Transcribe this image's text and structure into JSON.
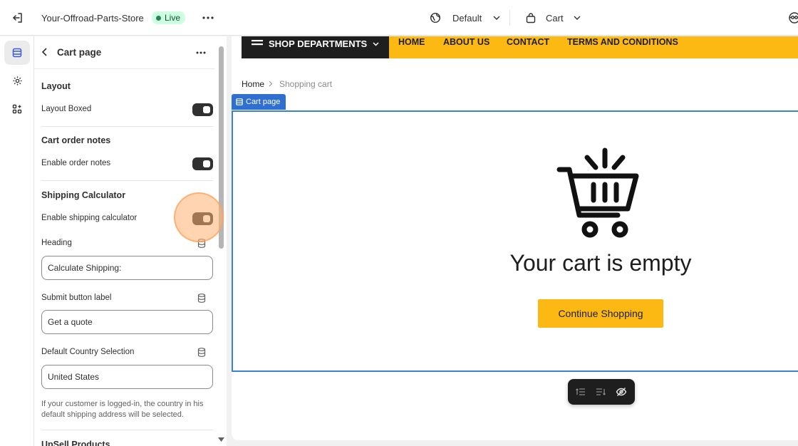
{
  "topbar": {
    "store_name": "Your-Offroad-Parts-Store",
    "status_badge": "Live",
    "theme_selector": "Default",
    "page_selector": "Cart"
  },
  "panel": {
    "title": "Cart page",
    "sections": {
      "layout": {
        "heading": "Layout",
        "toggle_label": "Layout Boxed",
        "toggle_on": true
      },
      "order_notes": {
        "heading": "Cart order notes",
        "toggle_label": "Enable order notes",
        "toggle_on": true
      },
      "shipping": {
        "heading": "Shipping Calculator",
        "toggle_label": "Enable shipping calculator",
        "toggle_on": true,
        "heading_field_label": "Heading",
        "heading_field_value": "Calculate Shipping:",
        "submit_label": "Submit button label",
        "submit_value": "Get a quote",
        "country_label": "Default Country Selection",
        "country_value": "United States",
        "help_text": "If your customer is logged-in, the country in his default shipping address will be selected."
      },
      "upsell": {
        "heading": "UpSell Products"
      }
    }
  },
  "preview": {
    "nav": {
      "departments": "SHOP DEPARTMENTS",
      "links": [
        "HOME",
        "ABOUT US",
        "CONTACT",
        "TERMS AND CONDITIONS"
      ]
    },
    "breadcrumb": {
      "home": "Home",
      "current": "Shopping cart"
    },
    "section_tag": "Cart page",
    "empty_message": "Your cart is empty",
    "continue_button": "Continue Shopping"
  },
  "colors": {
    "accent_yellow": "#fdb913",
    "selection_blue": "#2f6fcf",
    "live_badge_bg": "#cdfee1",
    "highlight_orange": "#ffb170"
  }
}
